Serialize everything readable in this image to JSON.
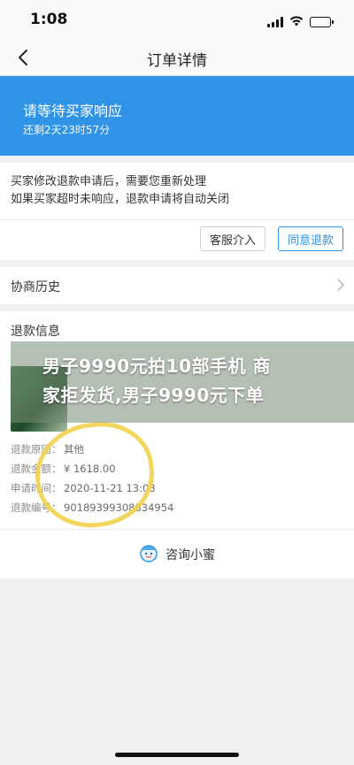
{
  "status_bar": {
    "time": "1:08",
    "icons": [
      "signal-icon",
      "wifi-icon",
      "battery-icon"
    ]
  },
  "nav": {
    "title": "订单详情",
    "back_icon": "back-arrow-icon"
  },
  "banner": {
    "title": "请等待买家响应",
    "countdown": "还剩2天23时57分",
    "color": "#2f94e6"
  },
  "notice": {
    "line1": "买家修改退款申请后，需要您重新处理",
    "line2": "如果买家超时未响应，退款申请将自动关闭",
    "service_button": "客服介入",
    "agree_button": "同意退款"
  },
  "history": {
    "label": "协商历史"
  },
  "refund": {
    "header": "退款信息",
    "rows": [
      {
        "key": "退款原因：",
        "value": "其他"
      },
      {
        "key": "退款金额：",
        "value": "¥ 1618.00"
      },
      {
        "key": "申请时间：",
        "value": "2020-11-21 13:03"
      },
      {
        "key": "退款编号：",
        "value": "90189399308834954"
      }
    ]
  },
  "overlay": {
    "line1": "男子9990元拍10部手机 商",
    "line2": "家拒发货,男子9990元下单"
  },
  "consult": {
    "label": "咨询小蜜",
    "icon": "assistant-mascot-icon"
  }
}
